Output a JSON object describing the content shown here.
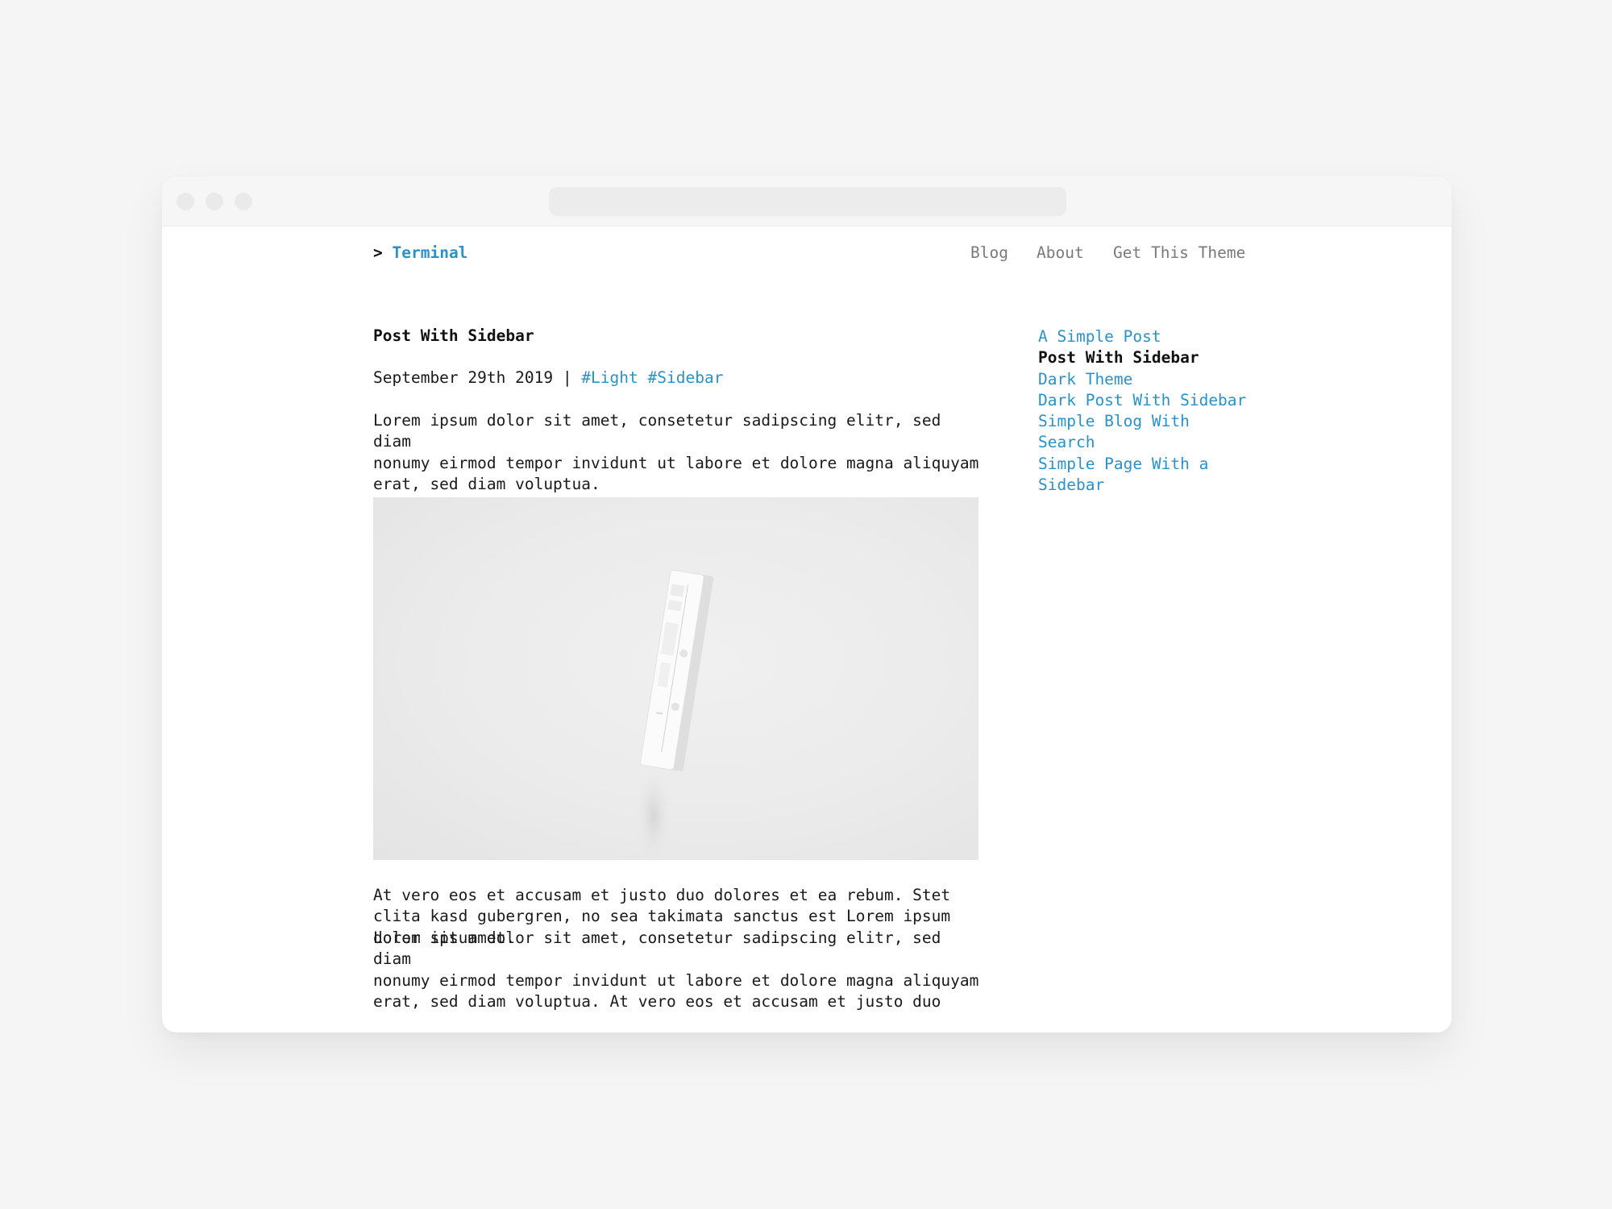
{
  "site": {
    "prompt": ">",
    "name": "Terminal"
  },
  "nav": {
    "items": [
      "Blog",
      "About",
      "Get This Theme"
    ]
  },
  "post": {
    "title": "Post With Sidebar",
    "date": "September 29th 2019",
    "separator": "|",
    "tags": [
      "#Light",
      "#Sidebar"
    ],
    "paragraphs": [
      "Lorem ipsum dolor sit amet, consetetur sadipscing elitr, sed diam\nnonumy eirmod tempor invidunt ut labore et dolore magna aliquyam\nerat, sed diam voluptua.",
      "At vero eos et accusam et justo duo dolores et ea rebum. Stet\nclita kasd gubergren, no sea takimata sanctus est Lorem ipsum\ndolor sit amet.",
      "Lorem ipsum dolor sit amet, consetetur sadipscing elitr, sed diam\nnonumy eirmod tempor invidunt ut labore et dolore magna aliquyam\nerat, sed diam voluptua. At vero eos et accusam et justo duo"
    ]
  },
  "sidebar": {
    "items": [
      {
        "label": "A Simple Post",
        "current": false
      },
      {
        "label": "Post With Sidebar",
        "current": true
      },
      {
        "label": "Dark Theme",
        "current": false
      },
      {
        "label": "Dark Post With Sidebar",
        "current": false
      },
      {
        "label": "Simple Blog With\nSearch",
        "current": false
      },
      {
        "label": "Simple Page With a\nSidebar",
        "current": false
      }
    ]
  },
  "colors": {
    "accent": "#2a92c8",
    "text": "#1a1a1a",
    "nav_text": "#7a7a7a",
    "background": "#f5f5f5"
  }
}
